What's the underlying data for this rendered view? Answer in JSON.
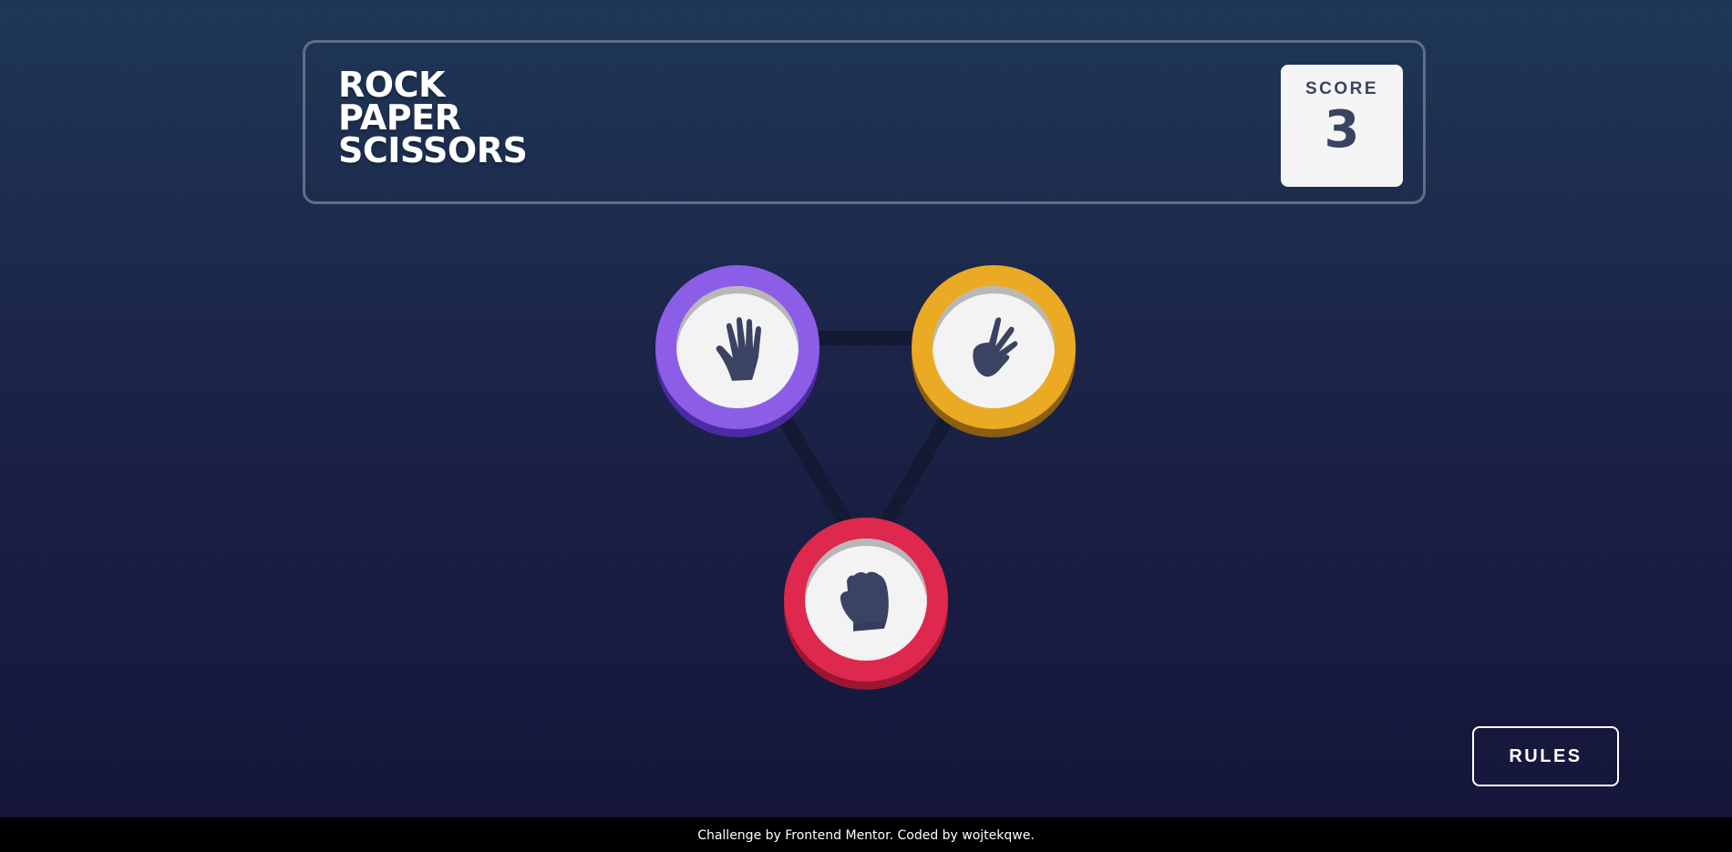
{
  "header": {
    "title_lines": [
      "ROCK",
      "PAPER",
      "SCISSORS"
    ],
    "score_label": "SCORE",
    "score_value": "3"
  },
  "choices": [
    {
      "name": "paper",
      "icon": "paper-hand-icon",
      "color": "#8c5ee8"
    },
    {
      "name": "scissors",
      "icon": "scissors-hand-icon",
      "color": "#ebaa24"
    },
    {
      "name": "rock",
      "icon": "rock-fist-icon",
      "color": "#df284e"
    }
  ],
  "rules_button": {
    "label": "RULES"
  },
  "footer": {
    "text": "Challenge by Frontend Mentor. Coded by wojtekqwe."
  },
  "colors": {
    "background_top": "#1f3756",
    "background_bottom": "#141539",
    "header_outline": "#606e85",
    "dark_text": "#3b4363",
    "triangle": "#141a33"
  }
}
